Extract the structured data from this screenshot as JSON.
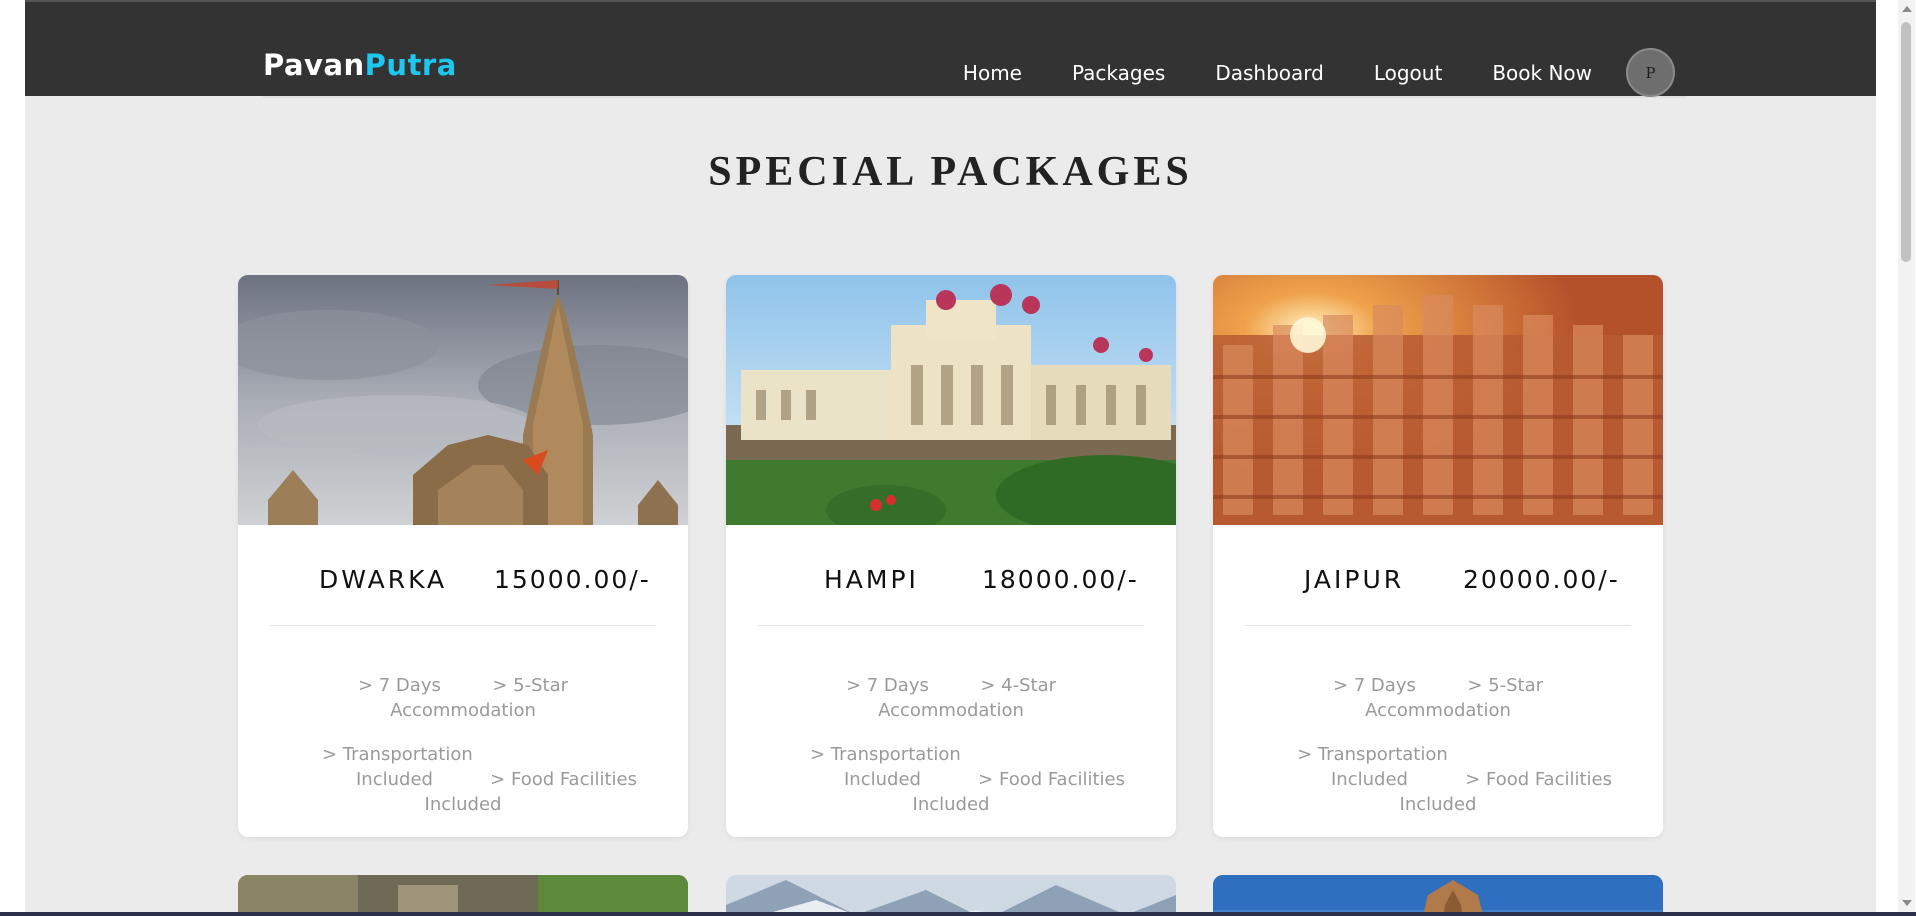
{
  "header": {
    "logo_part1": "Pavan",
    "logo_part2": "Putra",
    "nav": [
      "Home",
      "Packages",
      "Dashboard",
      "Logout",
      "Book Now"
    ],
    "avatar_initial": "P"
  },
  "main": {
    "heading": "SPECIAL PACKAGES",
    "packages": [
      {
        "place": "DWARKA",
        "price": "15000.00/-",
        "features": [
          "> 7 Days",
          "> 5-Star",
          "Accommodation",
          "> Transportation",
          "Included",
          "> Food Facilities",
          "Included"
        ]
      },
      {
        "place": "HAMPI",
        "price": "18000.00/-",
        "features": [
          "> 7 Days",
          "> 4-Star",
          "Accommodation",
          "> Transportation",
          "Included",
          "> Food Facilities",
          "Included"
        ]
      },
      {
        "place": "JAIPUR",
        "price": "20000.00/-",
        "features": [
          "> 7 Days",
          "> 5-Star",
          "Accommodation",
          "> Transportation",
          "Included",
          "> Food Facilities",
          "Included"
        ]
      }
    ]
  },
  "colors": {
    "header_bg": "#333333",
    "page_bg": "#ebebeb",
    "logo_accent": "#1ec7ef",
    "feature_text": "#9a9a9a"
  }
}
